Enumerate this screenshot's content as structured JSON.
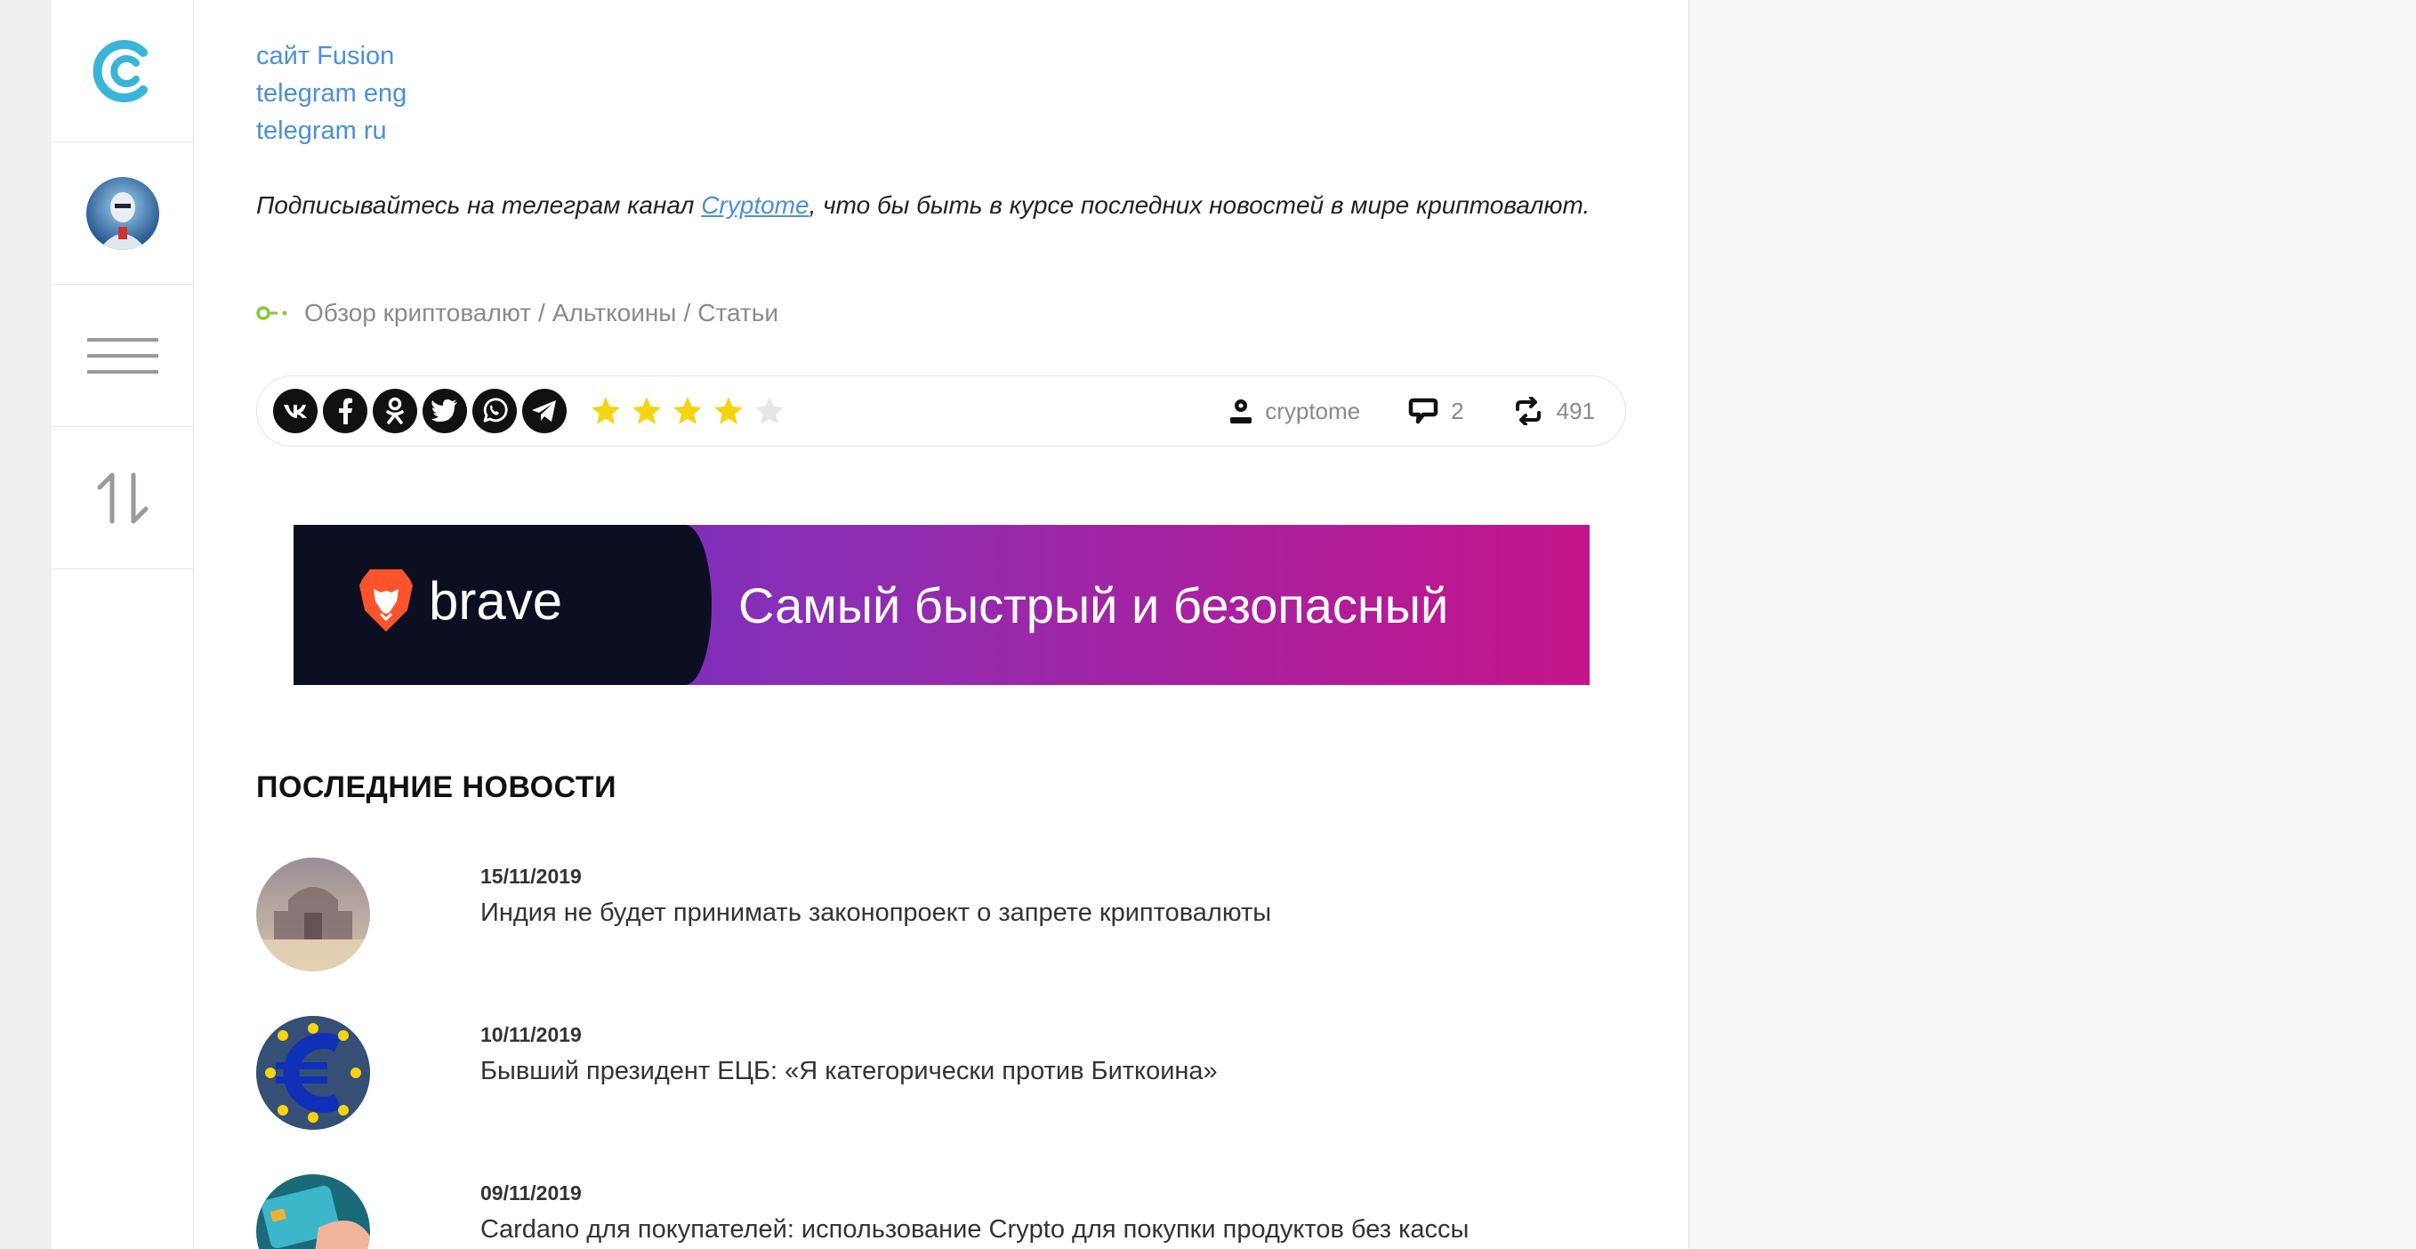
{
  "links": [
    "сайт Fusion",
    "telegram eng",
    "telegram ru"
  ],
  "promo": {
    "before": "Подписывайтесь на телеграм канал ",
    "link": "Cryptome",
    "after": ", что бы быть в курсе последних новостей в мире криптовалют."
  },
  "categories": [
    "Обзор криптовалют",
    "Альткоины",
    "Статьи"
  ],
  "category_separator": "/",
  "share": {
    "networks": [
      "vk-icon",
      "facebook-icon",
      "odnoklassniki-icon",
      "twitter-icon",
      "whatsapp-icon",
      "telegram-icon"
    ],
    "rating": 4,
    "rating_max": 5,
    "author": "cryptome",
    "comments": "2",
    "views": "491"
  },
  "banner": {
    "brand": "brave",
    "tagline": "Самый быстрый и безопасный"
  },
  "news": {
    "title": "ПОСЛЕДНИЕ НОВОСТИ",
    "items": [
      {
        "date": "15/11/2019",
        "headline": "Индия не будет принимать законопроект о запрете криптовалюты"
      },
      {
        "date": "10/11/2019",
        "headline": "Бывший президент ЕЦБ: «Я категорически против Биткоина»"
      },
      {
        "date": "09/11/2019",
        "headline": "Cardano для покупателей: использование Crypto для покупки продуктов без кассы"
      }
    ]
  },
  "colors": {
    "link": "#4a90d9",
    "star": "#f5d410",
    "star_empty": "#e6e6e6",
    "logo": "#3ab4d8",
    "category_icon": "#8cc63f"
  }
}
